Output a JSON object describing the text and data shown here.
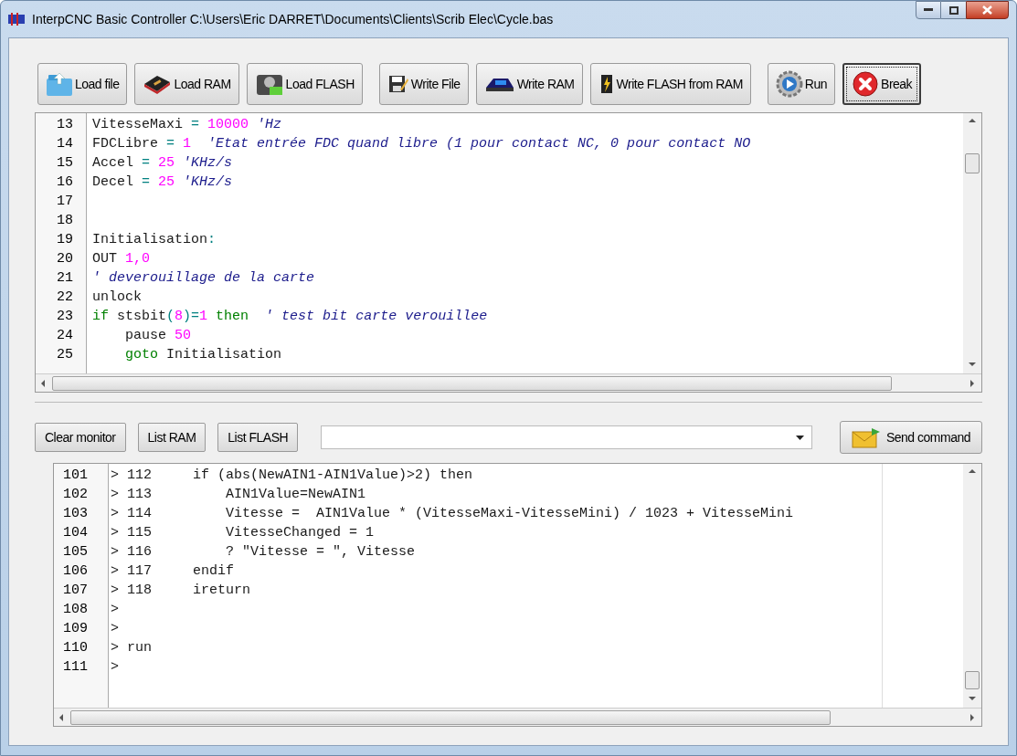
{
  "window": {
    "title": "InterpCNC Basic Controller C:\\Users\\Eric DARRET\\Documents\\Clients\\Scrib Elec\\Cycle.bas"
  },
  "toolbar": [
    {
      "label": "Load file",
      "kind": "folder",
      "focused": false
    },
    {
      "label": "Load RAM",
      "kind": "chip",
      "focused": false
    },
    {
      "label": "Load FLASH",
      "kind": "drive",
      "focused": false
    },
    {
      "label": "Write File",
      "kind": "save",
      "focused": false
    },
    {
      "label": "Write RAM",
      "kind": "ramwrite",
      "focused": false
    },
    {
      "label": "Write FLASH from RAM",
      "kind": "flash",
      "focused": false
    },
    {
      "label": "Run",
      "kind": "run",
      "focused": false
    },
    {
      "label": "Break",
      "kind": "stop",
      "focused": true
    }
  ],
  "editor": {
    "lines": [
      {
        "number": "13",
        "tokens": [
          {
            "kind": "text",
            "text": "VitesseMaxi "
          },
          {
            "kind": "op",
            "text": "="
          },
          {
            "kind": "num",
            "text": " 10000"
          },
          {
            "kind": "cmt",
            "text": " 'Hz"
          }
        ]
      },
      {
        "number": "14",
        "tokens": [
          {
            "kind": "text",
            "text": "FDCLibre "
          },
          {
            "kind": "op",
            "text": "="
          },
          {
            "kind": "num",
            "text": " 1"
          },
          {
            "kind": "cmt",
            "text": "  'Etat entrée FDC quand libre (1 pour contact NC, 0 pour contact NO"
          }
        ]
      },
      {
        "number": "15",
        "tokens": [
          {
            "kind": "text",
            "text": "Accel "
          },
          {
            "kind": "op",
            "text": "="
          },
          {
            "kind": "num",
            "text": " 25"
          },
          {
            "kind": "cmt",
            "text": " 'KHz/s"
          }
        ]
      },
      {
        "number": "16",
        "tokens": [
          {
            "kind": "text",
            "text": "Decel "
          },
          {
            "kind": "op",
            "text": "="
          },
          {
            "kind": "num",
            "text": " 25"
          },
          {
            "kind": "cmt",
            "text": " 'KHz/s"
          }
        ]
      },
      {
        "number": "17"
      },
      {
        "number": "18"
      },
      {
        "number": "19",
        "tokens": [
          {
            "kind": "text",
            "text": "Initialisation"
          },
          {
            "kind": "op",
            "text": ":"
          }
        ]
      },
      {
        "number": "20",
        "tokens": [
          {
            "kind": "text",
            "text": "OUT "
          },
          {
            "kind": "num",
            "text": "1,0"
          }
        ]
      },
      {
        "number": "21",
        "tokens": [
          {
            "kind": "cmt",
            "text": "' deverouillage de la carte"
          }
        ]
      },
      {
        "number": "22",
        "tokens": [
          {
            "kind": "text",
            "text": "unlock"
          }
        ]
      },
      {
        "number": "23",
        "tokens": [
          {
            "kind": "kw",
            "text": "if"
          },
          {
            "kind": "text",
            "text": " stsbit"
          },
          {
            "kind": "op",
            "text": "("
          },
          {
            "kind": "num",
            "text": "8"
          },
          {
            "kind": "op",
            "text": ")="
          },
          {
            "kind": "num",
            "text": "1"
          },
          {
            "kind": "kw",
            "text": " then"
          },
          {
            "kind": "cmt",
            "text": "  ' test bit carte verouillee"
          }
        ]
      },
      {
        "number": "24",
        "tokens": [
          {
            "kind": "text",
            "text": "    pause "
          },
          {
            "kind": "num",
            "text": "50"
          }
        ]
      },
      {
        "number": "25",
        "tokens": [
          {
            "kind": "kw",
            "text": "    goto"
          },
          {
            "kind": "text",
            "text": " Initialisation"
          }
        ]
      }
    ]
  },
  "monitor_buttons": [
    {
      "label": "Clear monitor"
    },
    {
      "label": "List RAM"
    },
    {
      "label": "List FLASH"
    }
  ],
  "send_button": {
    "label": "Send command"
  },
  "monitor": {
    "lines": [
      {
        "number": "101",
        "text": "> 112     if (abs(NewAIN1-AIN1Value)>2) then"
      },
      {
        "number": "102",
        "text": "> 113         AIN1Value=NewAIN1"
      },
      {
        "number": "103",
        "text": "> 114         Vitesse =  AIN1Value * (VitesseMaxi-VitesseMini) / 1023 + VitesseMini"
      },
      {
        "number": "104",
        "text": "> 115         VitesseChanged = 1"
      },
      {
        "number": "105",
        "text": "> 116         ? \"Vitesse = \", Vitesse"
      },
      {
        "number": "106",
        "text": "> 117     endif"
      },
      {
        "number": "107",
        "text": "> 118     ireturn"
      },
      {
        "number": "108",
        "text": ">"
      },
      {
        "number": "109",
        "text": ">"
      },
      {
        "number": "110",
        "text": "> run"
      },
      {
        "number": "111",
        "text": ">"
      }
    ]
  }
}
